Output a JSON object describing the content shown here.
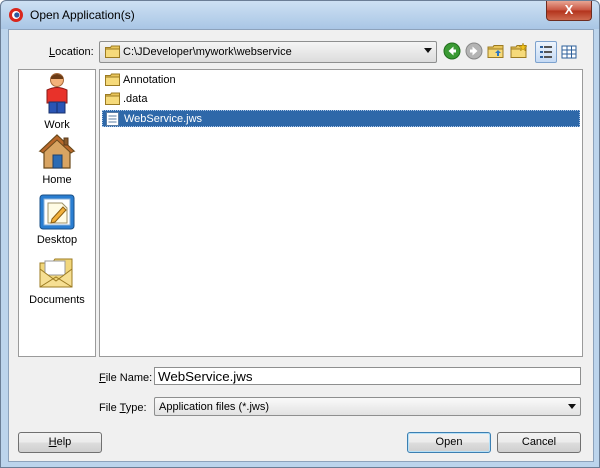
{
  "window": {
    "title": "Open Application(s)",
    "close_label": "X"
  },
  "location": {
    "label_mnemonic": "L",
    "label_rest": "ocation:",
    "path": "C:\\JDeveloper\\mywork\\webservice"
  },
  "toolbar": {
    "icons": [
      "back-icon",
      "forward-icon",
      "up-folder-icon",
      "new-folder-icon",
      "list-view-icon",
      "details-view-icon"
    ]
  },
  "places": [
    {
      "label": "Work",
      "icon": "work-person-icon"
    },
    {
      "label": "Home",
      "icon": "home-icon"
    },
    {
      "label": "Desktop",
      "icon": "desktop-icon"
    },
    {
      "label": "Documents",
      "icon": "documents-icon"
    }
  ],
  "files": [
    {
      "name": "Annotation",
      "type": "folder"
    },
    {
      "name": ".data",
      "type": "folder"
    },
    {
      "name": "WebService.jws",
      "type": "file",
      "selected": true
    }
  ],
  "file_name": {
    "label_mnemonic": "F",
    "label_rest": "ile Name:",
    "value": "WebService.jws"
  },
  "file_type": {
    "label_pre": "File ",
    "label_mnemonic": "T",
    "label_rest": "ype:",
    "value": "Application files  (*.jws)"
  },
  "buttons": {
    "help_mnemonic": "H",
    "help_rest": "elp",
    "open": "Open",
    "cancel": "Cancel"
  },
  "colors": {
    "selection": "#2e68a9",
    "title_gradient_top": "#cde0f3",
    "client_bg": "#f0f0f0"
  }
}
